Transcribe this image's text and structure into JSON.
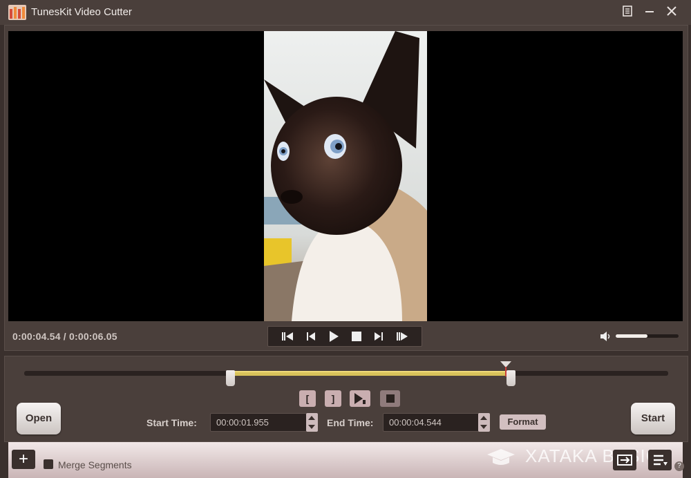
{
  "window": {
    "title": "TunesKit Video Cutter",
    "menu_icon": "menu-icon",
    "minimize_icon": "minimize-icon",
    "close_icon": "close-icon"
  },
  "player": {
    "time_display": "0:00:04.54 / 0:00:06.05",
    "volume_level": 0.5,
    "controls": [
      "previous-segment-icon",
      "previous-frame-icon",
      "play-icon",
      "stop-icon",
      "next-frame-icon",
      "next-segment-icon"
    ]
  },
  "timeline": {
    "selection_start_fraction": 0.32,
    "selection_end_fraction": 0.755,
    "playhead_fraction": 0.751
  },
  "segment_controls": {
    "mark_in_label": "[",
    "mark_out_label": "]"
  },
  "actions": {
    "open_label": "Open",
    "start_label": "Start",
    "format_label": "Format"
  },
  "times": {
    "start_label": "Start Time:",
    "start_value": "00:00:01.955",
    "end_label": "End Time:",
    "end_value": "00:00:04.544"
  },
  "footer": {
    "add_label": "+",
    "merge_label": "Merge Segments",
    "watermark": "XATAKA BASICS"
  },
  "colors": {
    "background": "#3a302d",
    "panel": "#4a3f3b",
    "selection": "#d8c25a",
    "accent_button": "#c9aeb0"
  }
}
